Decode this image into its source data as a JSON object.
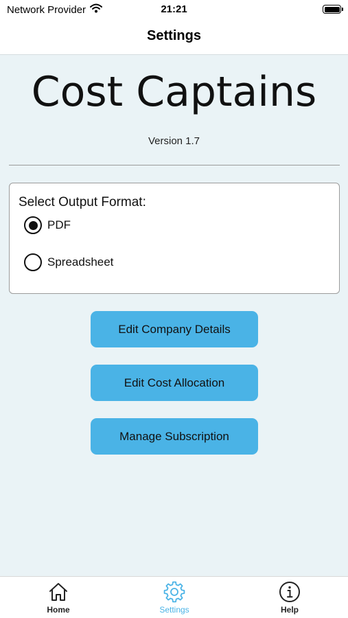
{
  "status_bar": {
    "carrier": "Network Provider",
    "time": "21:21"
  },
  "nav": {
    "title": "Settings"
  },
  "app": {
    "name": "Cost Captains",
    "version": "Version 1.7"
  },
  "output_format": {
    "label": "Select Output Format:",
    "options": [
      {
        "label": "PDF",
        "selected": true
      },
      {
        "label": "Spreadsheet",
        "selected": false
      }
    ]
  },
  "buttons": {
    "edit_company": "Edit Company Details",
    "edit_cost": "Edit Cost Allocation",
    "manage_subscription": "Manage Subscription"
  },
  "tab_bar": {
    "items": [
      {
        "label": "Home",
        "icon": "home-icon"
      },
      {
        "label": "Settings",
        "icon": "gear-icon",
        "active": true
      },
      {
        "label": "Help",
        "icon": "info-icon"
      }
    ]
  },
  "colors": {
    "accent": "#4ab3e6",
    "background": "#eaf3f6"
  }
}
